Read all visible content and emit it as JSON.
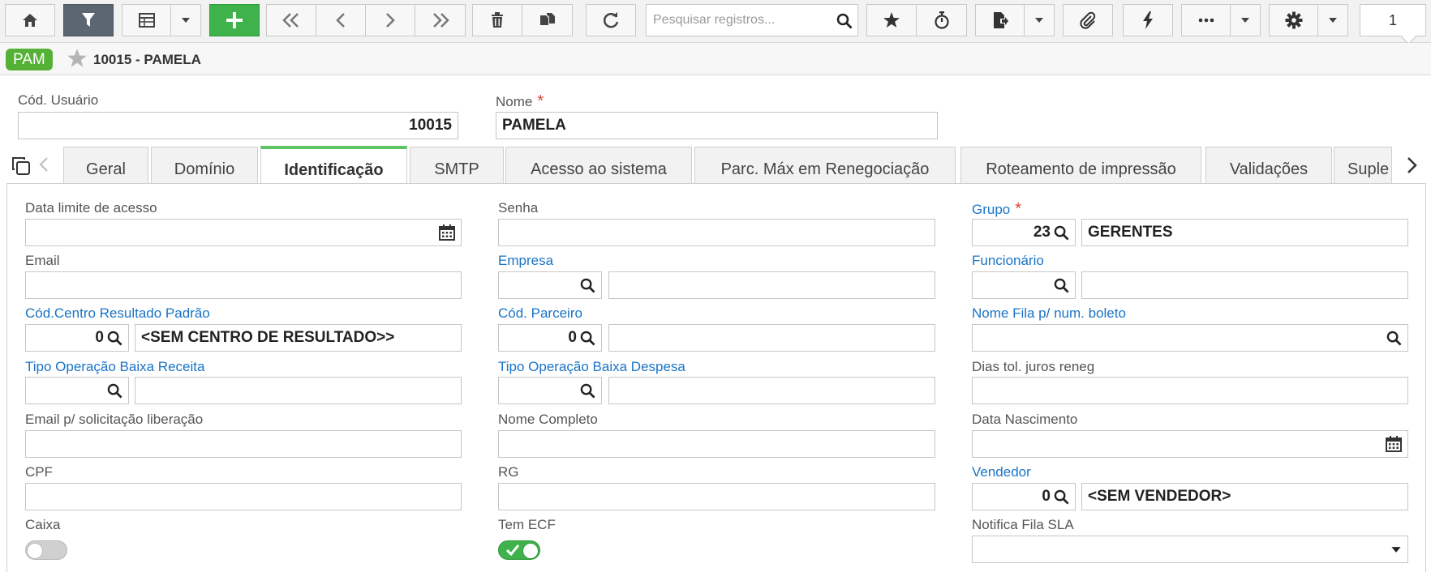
{
  "toolbar": {
    "search_placeholder": "Pesquisar registros...",
    "page_number": "1"
  },
  "header": {
    "badge": "PAM",
    "title": "10015 - PAMELA"
  },
  "top_fields": {
    "cod_usuario_label": "Cód. Usuário",
    "cod_usuario_value": "10015",
    "nome_label": "Nome",
    "nome_value": "PAMELA",
    "required_mark": "*"
  },
  "tabs": [
    {
      "label": "Geral"
    },
    {
      "label": "Domínio"
    },
    {
      "label": "Identificação"
    },
    {
      "label": "SMTP"
    },
    {
      "label": "Acesso ao sistema"
    },
    {
      "label": "Parc. Máx em Renegociação"
    },
    {
      "label": "Roteamento de impressão"
    },
    {
      "label": "Validações"
    },
    {
      "label": "Suple"
    }
  ],
  "form": {
    "data_limite_label": "Data limite de acesso",
    "senha_label": "Senha",
    "grupo_label": "Grupo",
    "grupo_code": "23",
    "grupo_name": "GERENTES",
    "email_label": "Email",
    "empresa_label": "Empresa",
    "funcionario_label": "Funcionário",
    "centro_label": "Cód.Centro Resultado Padrão",
    "centro_code": "0",
    "centro_name": "<SEM CENTRO DE RESULTADO>>",
    "parceiro_label": "Cód. Parceiro",
    "parceiro_code": "0",
    "fila_boleto_label": "Nome Fila p/ num. boleto",
    "top_receita_label": "Tipo Operação Baixa Receita",
    "top_despesa_label": "Tipo Operação Baixa Despesa",
    "dias_tol_label": "Dias tol. juros reneg",
    "email_lib_label": "Email p/ solicitação liberação",
    "nome_completo_label": "Nome Completo",
    "data_nasc_label": "Data Nascimento",
    "cpf_label": "CPF",
    "rg_label": "RG",
    "vendedor_label": "Vendedor",
    "vendedor_code": "0",
    "vendedor_name": "<SEM VENDEDOR>",
    "caixa_label": "Caixa",
    "caixa_on": false,
    "ecf_label": "Tem ECF",
    "ecf_on": true,
    "notifica_label": "Notifica Fila SLA"
  },
  "colors": {
    "accent_green": "#3fb24b",
    "badge_green": "#55b135",
    "link_blue": "#1a74c6",
    "required_red": "#d9452e",
    "tab_active_border": "#5cc461"
  },
  "icons": [
    "home-icon",
    "filter-icon",
    "grid-icon",
    "chevron-down-icon",
    "plus-icon",
    "first-page-icon",
    "previous-icon",
    "next-icon",
    "last-page-icon",
    "trash-icon",
    "copy-icon",
    "refresh-icon",
    "search-icon",
    "star-icon",
    "timer-icon",
    "export-icon",
    "paperclip-icon",
    "lightning-icon",
    "more-icon",
    "gear-icon",
    "calendar-icon",
    "toggle-check-icon",
    "chevron-left-icon",
    "chevron-right-icon",
    "duplicate-icon"
  ]
}
